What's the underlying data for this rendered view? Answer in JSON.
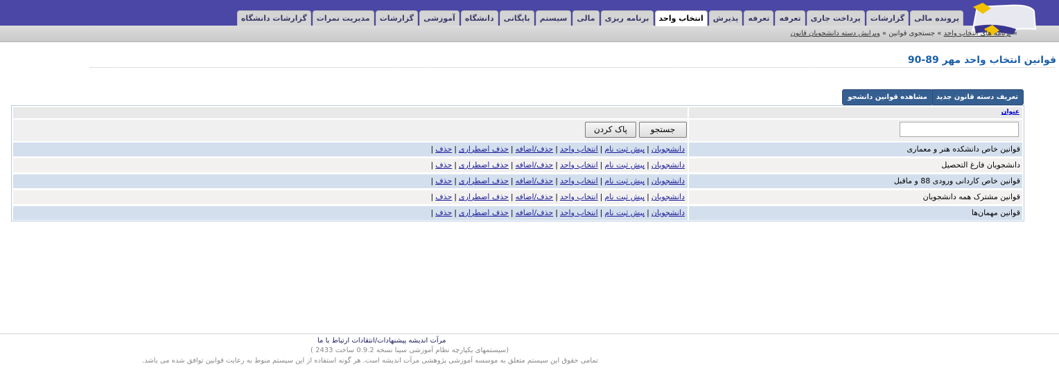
{
  "header": {
    "tabs": [
      {
        "label": "پرونده مالی",
        "active": false
      },
      {
        "label": "گزارشات",
        "active": false
      },
      {
        "label": "پرداخت جاری",
        "active": false
      },
      {
        "label": "تعرفه",
        "active": false
      },
      {
        "label": "تعرفه",
        "active": false
      },
      {
        "label": "پذیرش",
        "active": false
      },
      {
        "label": "انتخاب واحد",
        "active": true
      },
      {
        "label": "برنامه ریزی",
        "active": false
      },
      {
        "label": "مالی",
        "active": false
      },
      {
        "label": "سیستم",
        "active": false
      },
      {
        "label": "بایگانی",
        "active": false
      },
      {
        "label": "دانشگاه",
        "active": false
      },
      {
        "label": "آموزشی",
        "active": false
      },
      {
        "label": "گزارشات",
        "active": false
      },
      {
        "label": "مدیریت نمرات",
        "active": false
      },
      {
        "label": "گزارشات دانشگاه",
        "active": false
      }
    ],
    "breadcrumb": {
      "sep": "»",
      "item1": "برنامه های انتخاب واحد",
      "item2": "جستجوی قوانین",
      "item3": "ویرایش دسته دانشجویان قانون"
    }
  },
  "page": {
    "title": "قوانین انتخاب واحد مهر 89-90"
  },
  "actions": {
    "view_rules": "مشاهده قوانین دانشجو",
    "define_new": "تعریف دسته قانون جدید"
  },
  "grid": {
    "column_title": "عنوان",
    "search_button": "جستجو",
    "clear_button": "پاک کردن",
    "link_labels": {
      "students": "دانشجویان",
      "pre_register": "پیش ثبت نام",
      "course_select": "انتخاب واحد",
      "add_drop": "حذف/اضافه",
      "emergency_drop": "حذف اضطراری",
      "delete": "حذف"
    },
    "rows": [
      {
        "title": "قوانین خاص دانشکده هنر و معماری"
      },
      {
        "title": "دانشجویان فارغ التحصیل"
      },
      {
        "title": "قوانین خاص کاردانی ورودی 88 و ماقبل"
      },
      {
        "title": "قوانین مشترک همه دانشجویان"
      },
      {
        "title": "قوانین مهمان‌ها"
      }
    ]
  },
  "footer": {
    "brand": "مرآت اندیشه",
    "feedback": "پیشنهادات/انتقادات",
    "contact": "ارتباط با ما",
    "version": "(سیستمهای یکپارچه نظام آموزشی سینا نسخه 0.9.2 ساخت 2433 )",
    "copyright": "تمامی حقوق این سیستم متعلق به موسسه آموزشی پژوهشی مرآت اندیشه است. هر گونه استفاده از این سیستم منوط به رعایت قوانین توافق شده می باشد."
  }
}
